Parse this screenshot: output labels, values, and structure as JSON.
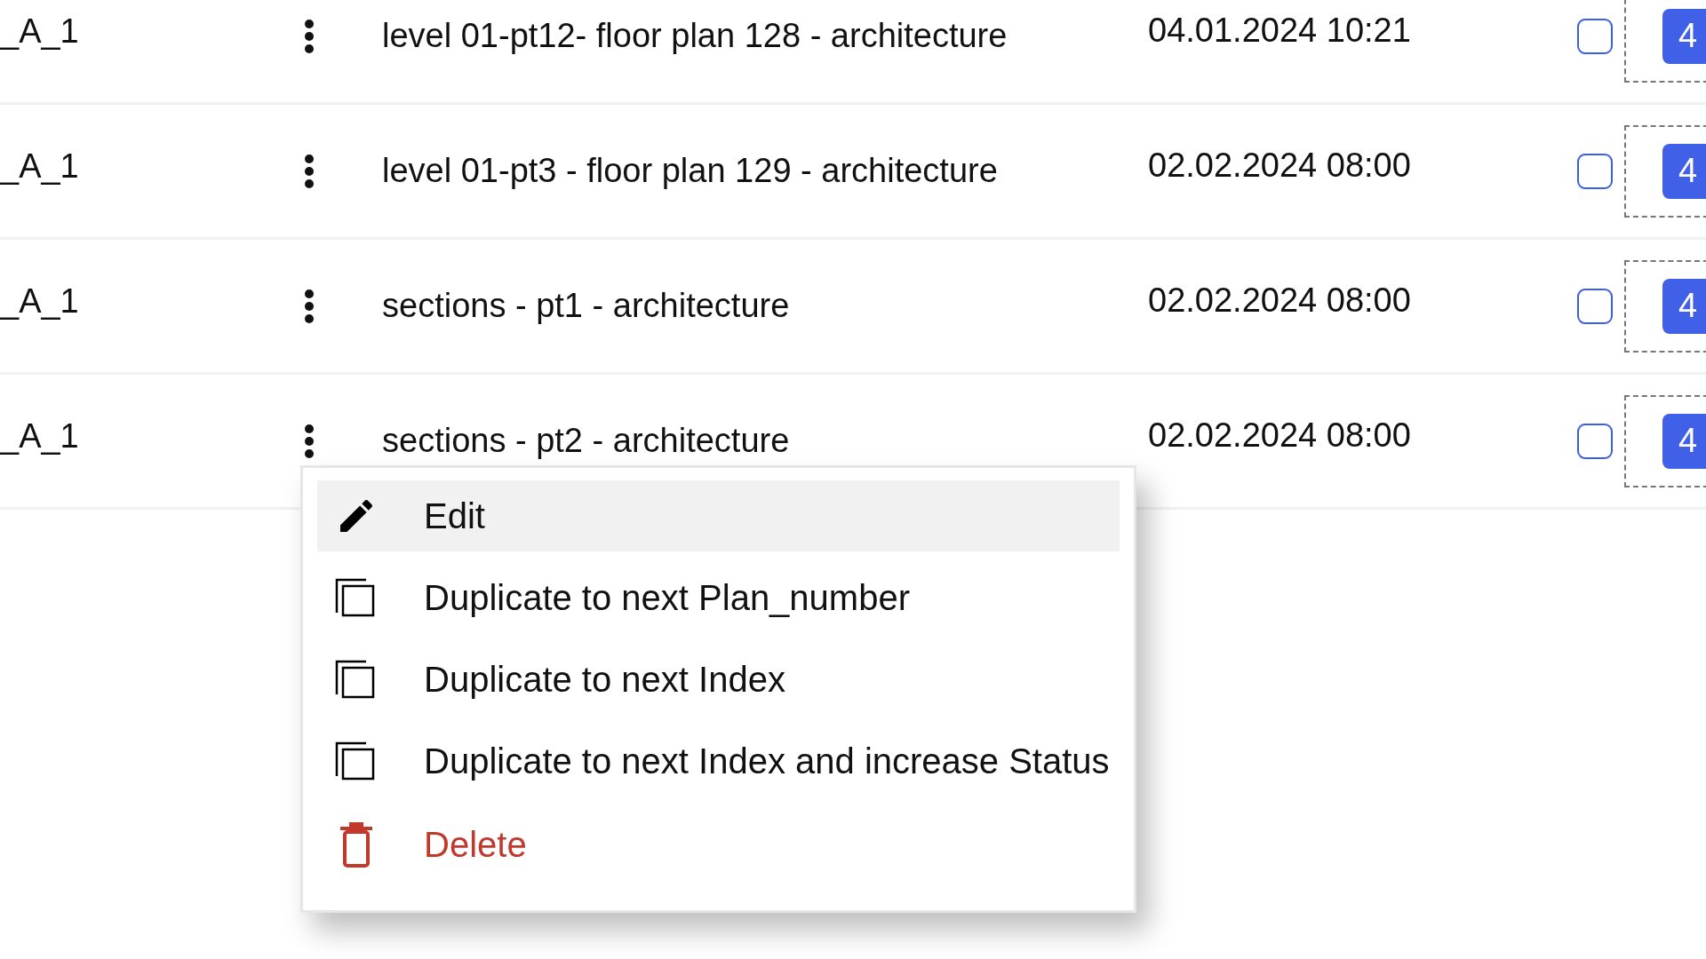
{
  "table": {
    "rows": [
      {
        "code": "_A_1",
        "name": "level 01-pt12- floor plan 128 - architecture",
        "date": "04.01.2024 10:21",
        "checked": false,
        "badge": "4"
      },
      {
        "code": "_A_1",
        "name": "level 01-pt3 - floor plan 129 - architecture",
        "date": "02.02.2024 08:00",
        "checked": false,
        "badge": "4"
      },
      {
        "code": "_A_1",
        "name": "sections - pt1 - architecture",
        "date": "02.02.2024 08:00",
        "checked": false,
        "badge": "4"
      },
      {
        "code": "_A_1",
        "name": "sections - pt2 - architecture",
        "date": "02.02.2024 08:00",
        "checked": false,
        "badge": "4"
      }
    ]
  },
  "context_menu": {
    "items": [
      {
        "kind": "edit",
        "label": "Edit",
        "selected": true
      },
      {
        "kind": "duplicate",
        "label": "Duplicate to next Plan_number",
        "selected": false
      },
      {
        "kind": "duplicate",
        "label": "Duplicate to next Index",
        "selected": false
      },
      {
        "kind": "duplicate",
        "label": "Duplicate to next Index and increase Status",
        "selected": false
      },
      {
        "kind": "delete",
        "label": "Delete",
        "selected": false
      }
    ]
  }
}
